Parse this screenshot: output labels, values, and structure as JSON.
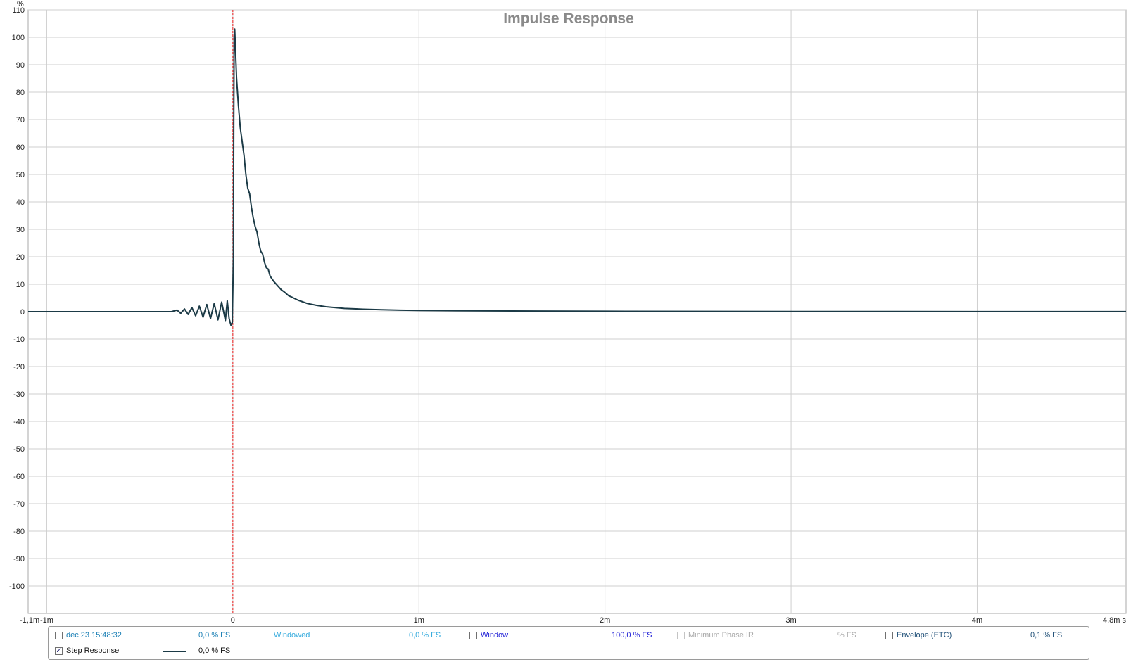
{
  "chart_data": {
    "type": "line",
    "title": "Impulse Response",
    "ylabel": "%",
    "xlim": [
      -0.0011,
      0.0048
    ],
    "ylim": [
      -110,
      110
    ],
    "x_unit_label": "s",
    "y_ticks": [
      110,
      100,
      90,
      80,
      70,
      60,
      50,
      40,
      30,
      20,
      10,
      0,
      -10,
      -20,
      -30,
      -40,
      -50,
      -60,
      -70,
      -80,
      -90,
      -100
    ],
    "x_ticks": [
      {
        "value": -0.0011,
        "label": "-1,1m"
      },
      {
        "value": -0.001,
        "label": "-1m"
      },
      {
        "value": 0,
        "label": "0"
      },
      {
        "value": 0.001,
        "label": "1m"
      },
      {
        "value": 0.002,
        "label": "2m"
      },
      {
        "value": 0.003,
        "label": "3m"
      },
      {
        "value": 0.004,
        "label": "4m"
      },
      {
        "value": 0.0048,
        "label": "4,8m s"
      }
    ],
    "grid": true,
    "marker_line_x": 0,
    "series": [
      {
        "name": "Step Response",
        "color": "#1b3a46",
        "points": [
          [
            -0.0011,
            0
          ],
          [
            -0.00033,
            0
          ],
          [
            -0.0003,
            0.6
          ],
          [
            -0.00028,
            -0.6
          ],
          [
            -0.00026,
            1.0
          ],
          [
            -0.00024,
            -1.0
          ],
          [
            -0.00022,
            1.5
          ],
          [
            -0.0002,
            -1.5
          ],
          [
            -0.00018,
            2.0
          ],
          [
            -0.00016,
            -2.0
          ],
          [
            -0.00014,
            2.6
          ],
          [
            -0.00012,
            -2.5
          ],
          [
            -0.0001,
            3.0
          ],
          [
            -8e-05,
            -3.0
          ],
          [
            -6e-05,
            3.5
          ],
          [
            -4e-05,
            -3.2
          ],
          [
            -3e-05,
            4.0
          ],
          [
            -2e-05,
            -2.5
          ],
          [
            -1e-05,
            -5.0
          ],
          [
            -3e-06,
            -4.0
          ],
          [
            3e-06,
            20
          ],
          [
            5e-06,
            70
          ],
          [
            7e-06,
            100
          ],
          [
            1e-05,
            103
          ],
          [
            2e-05,
            85
          ],
          [
            3e-05,
            75
          ],
          [
            4e-05,
            67
          ],
          [
            5e-05,
            62
          ],
          [
            6e-05,
            57
          ],
          [
            7e-05,
            50
          ],
          [
            8e-05,
            45
          ],
          [
            9e-05,
            43
          ],
          [
            0.0001,
            38
          ],
          [
            0.00011,
            34
          ],
          [
            0.00012,
            31
          ],
          [
            0.00013,
            29
          ],
          [
            0.00014,
            25
          ],
          [
            0.00015,
            22
          ],
          [
            0.00016,
            21
          ],
          [
            0.00017,
            18
          ],
          [
            0.00018,
            16
          ],
          [
            0.00019,
            15.5
          ],
          [
            0.0002,
            13
          ],
          [
            0.00022,
            11
          ],
          [
            0.00024,
            9.5
          ],
          [
            0.00026,
            8
          ],
          [
            0.00028,
            7
          ],
          [
            0.0003,
            5.8
          ],
          [
            0.00032,
            5.2
          ],
          [
            0.00035,
            4.2
          ],
          [
            0.0004,
            3
          ],
          [
            0.00045,
            2.3
          ],
          [
            0.0005,
            1.8
          ],
          [
            0.0006,
            1.2
          ],
          [
            0.0007,
            0.9
          ],
          [
            0.0008,
            0.7
          ],
          [
            0.0009,
            0.55
          ],
          [
            0.001,
            0.45
          ],
          [
            0.0012,
            0.35
          ],
          [
            0.0015,
            0.25
          ],
          [
            0.002,
            0.15
          ],
          [
            0.003,
            0.07
          ],
          [
            0.004,
            0.04
          ],
          [
            0.0048,
            0.03
          ]
        ]
      }
    ]
  },
  "legend": {
    "row1": [
      {
        "label": "dec 23 15:48:32",
        "value": "0,0 % FS",
        "checked": false,
        "enabled": true,
        "label_color": "#1a7fb5",
        "value_color": "#1a7fb5"
      },
      {
        "label": "Windowed",
        "value": "0,0 % FS",
        "checked": false,
        "enabled": true,
        "label_color": "#33aadd",
        "value_color": "#33aadd"
      },
      {
        "label": "Window",
        "value": "100,0 % FS",
        "checked": false,
        "enabled": true,
        "label_color": "#1d1dd6",
        "value_color": "#1d1dd6"
      },
      {
        "label": "Minimum Phase IR",
        "value": "% FS",
        "checked": false,
        "enabled": false,
        "label_color": "#a8a8a8",
        "value_color": "#a8a8a8"
      },
      {
        "label": "Envelope (ETC)",
        "value": "0,1 % FS",
        "checked": false,
        "enabled": true,
        "label_color": "#1f4f77",
        "value_color": "#1f4f77"
      }
    ],
    "row2": [
      {
        "label": "Step Response",
        "value": "0,0 % FS",
        "checked": true,
        "enabled": true,
        "label_color": "#111111",
        "value_color": "#111111",
        "swatch_color": "#1b3a46"
      }
    ],
    "check_glyph": "✓"
  }
}
